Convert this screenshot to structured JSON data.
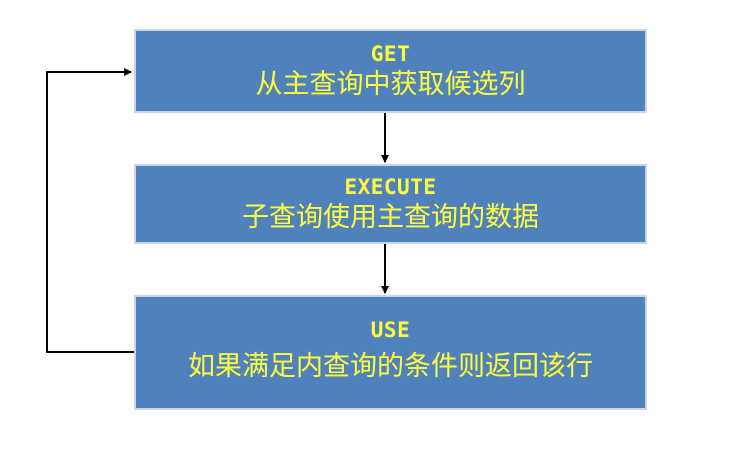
{
  "diagram": {
    "nodes": [
      {
        "id": "get",
        "title": "GET",
        "text": "从主查询中获取候选列"
      },
      {
        "id": "execute",
        "title": "EXECUTE",
        "text": "子查询使用主查询的数据"
      },
      {
        "id": "use",
        "title": "USE",
        "text": "如果满足内查询的条件则返回该行"
      }
    ],
    "edges": [
      {
        "from": "get",
        "to": "execute"
      },
      {
        "from": "execute",
        "to": "use"
      },
      {
        "from": "use",
        "to": "get"
      }
    ],
    "colors": {
      "box_fill": "#4f81bd",
      "box_border": "#c9d4e4",
      "text": "#ffff3c",
      "arrow": "#000000"
    }
  }
}
